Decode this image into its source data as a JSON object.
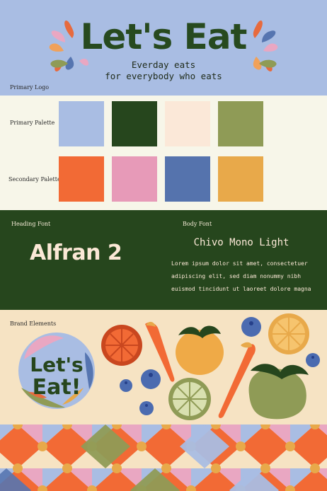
{
  "logo": {
    "title": "Let's Eat",
    "tagline_line1": "Everday eats",
    "tagline_line2": "for everybody who eats",
    "section_label": "Primary Logo"
  },
  "palette": {
    "primary_label": "Primary Palette",
    "secondary_label": "Secondary Palette",
    "primary": [
      "#a9bde3",
      "#26461d",
      "#fbe8d8",
      "#8f9b56"
    ],
    "secondary": [
      "#f26a35",
      "#e79ab8",
      "#5573ad",
      "#e8a94a"
    ]
  },
  "fonts": {
    "heading_label": "Heading Font",
    "body_label": "Body Font",
    "heading_sample": "Alfran 2",
    "body_title": "Chivo Mono Light",
    "body_lines": [
      "Lorem ipsum dolor sit amet, consectetuer",
      "adipiscing elit, sed diam nonummy nibh",
      "euismod tincidunt ut laoreet dolore magna"
    ]
  },
  "brand": {
    "section_label": "Brand Elements",
    "badge_line1": "Let's",
    "badge_line2": "Eat!",
    "icons": [
      "orange-slice-icon",
      "carrot-icon",
      "tomato-icon",
      "blueberry-icon",
      "lime-slice-icon",
      "orange-slice-icon",
      "heirloom-tomato-icon"
    ]
  }
}
